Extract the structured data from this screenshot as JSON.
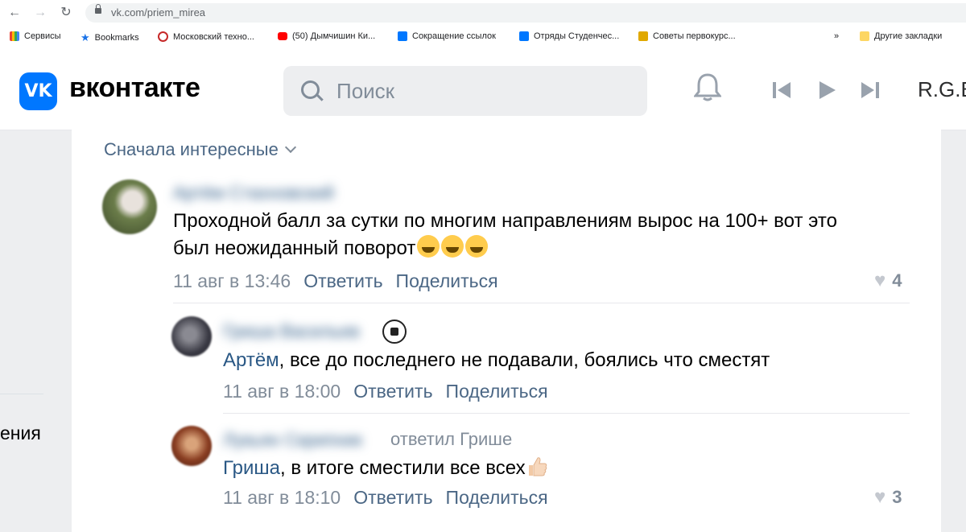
{
  "browser": {
    "url": "vk.com/priem_mirea",
    "bookmarks": [
      "Сервисы",
      "Bookmarks",
      "Московский техно...",
      "(50) Дымчишин Ки...",
      "Сокращение ссылок",
      "Отряды Студенчес...",
      "Советы первокурс..."
    ],
    "overflow": "»",
    "other_bookmarks": "Другие закладки"
  },
  "vk": {
    "logo_letters": "VK",
    "brand": "вконтакте",
    "search_placeholder": "Поиск",
    "user_initials": "R.G.B"
  },
  "sidebar": {
    "fragment": "ения"
  },
  "sort": {
    "label": "Сначала интересные"
  },
  "comments": [
    {
      "author": "Артём Стахновский",
      "text_line1": "Проходной балл за сутки по многим направлениям вырос на 100+ вот это",
      "text_line2": "был неожиданный поворот",
      "time": "11 авг в 13:46",
      "reply_label": "Ответить",
      "share_label": "Поделиться",
      "likes": "4"
    },
    {
      "author": "Гриша Васильев",
      "mention": "Артём",
      "text": ", все до последнего не подавали, боялись что сместят",
      "time": "11 авг в 18:00",
      "reply_label": "Ответить",
      "share_label": "Поделиться"
    },
    {
      "author": "Лукьян Скрипник",
      "replied_to": "ответил Грише",
      "mention": "Гриша",
      "text": ", в итоге сместили все всех",
      "time": "11 авг в 18:10",
      "reply_label": "Ответить",
      "share_label": "Поделиться",
      "likes": "3"
    }
  ],
  "colors": {
    "vk_blue": "#0077ff",
    "link": "#2a5885",
    "muted": "#818c99"
  }
}
